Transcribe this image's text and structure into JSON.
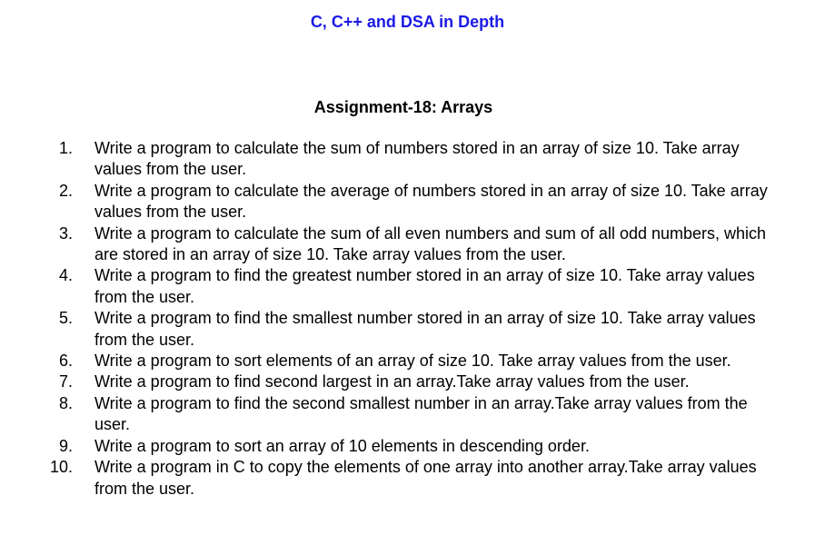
{
  "header": {
    "title": "C, C++ and DSA in Depth",
    "title_color": "#1a1ae6"
  },
  "assignment": {
    "title": "Assignment-18: Arrays"
  },
  "items": [
    {
      "num": "1.",
      "text": "Write a program to calculate the sum of numbers stored in an array of size 10. Take array values from the user."
    },
    {
      "num": "2.",
      "text": "Write a program to calculate the average of numbers stored in an array of size 10. Take array values from the user."
    },
    {
      "num": "3.",
      "text": "Write a program to calculate the sum of all even numbers and sum of all odd numbers, which are stored in an array of size 10. Take array values from the user."
    },
    {
      "num": "4.",
      "text": "Write a program to find the greatest number stored in an array of size 10. Take array values from the user."
    },
    {
      "num": "5.",
      "text": "Write a program to find the smallest number stored in an array of size 10. Take array values from the user."
    },
    {
      "num": "6.",
      "text": "Write a program to sort elements of an array of size 10. Take array values from the user."
    },
    {
      "num": "7.",
      "text": "Write a program to find second largest in an array.Take array values from the user."
    },
    {
      "num": "8.",
      "text": "Write a program to find the second smallest number in an array.Take array values from the user."
    },
    {
      "num": "9.",
      "text": "Write a program to sort an array of 10 elements in descending order."
    },
    {
      "num": "10.",
      "text": "Write a program in C to copy the elements of one array into another array.Take array values from the user."
    }
  ]
}
